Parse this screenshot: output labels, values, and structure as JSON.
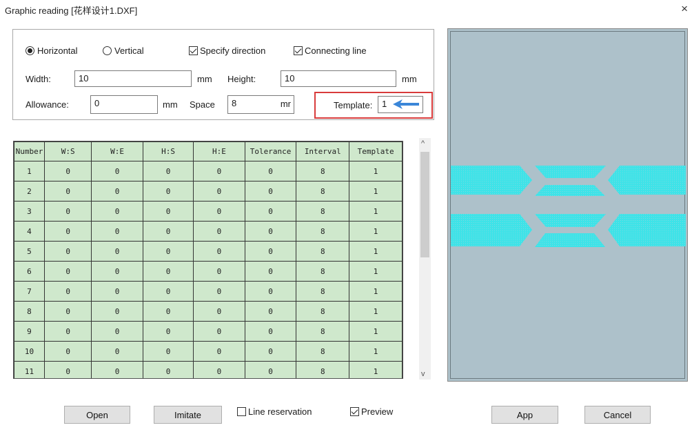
{
  "window": {
    "title": "Graphic reading [花样设计1.DXF]",
    "close_glyph": "×"
  },
  "options": {
    "horizontal_label": "Horizontal",
    "horizontal_selected": true,
    "vertical_label": "Vertical",
    "vertical_selected": false,
    "specify_direction_label": "Specify direction",
    "specify_direction_checked": true,
    "connecting_line_label": "Connecting line",
    "connecting_line_checked": true
  },
  "fields": {
    "width_label": "Width:",
    "width_value": "10",
    "width_unit": "mm",
    "height_label": "Height:",
    "height_value": "10",
    "height_unit": "mm",
    "allowance_label": "Allowance:",
    "allowance_value": "0",
    "allowance_unit": "mm",
    "space_label": "Space",
    "space_value": "8",
    "space_unit": "mr",
    "template_label": "Template:",
    "template_value": "1"
  },
  "highlight_color": "#d83b3b",
  "arrow_color": "#3a86d8",
  "table": {
    "headers": [
      "Number",
      "W:S",
      "W:E",
      "H:S",
      "H:E",
      "Tolerance",
      "Interval",
      "Template"
    ],
    "rows": [
      [
        "1",
        "0",
        "0",
        "0",
        "0",
        "0",
        "8",
        "1"
      ],
      [
        "2",
        "0",
        "0",
        "0",
        "0",
        "0",
        "8",
        "1"
      ],
      [
        "3",
        "0",
        "0",
        "0",
        "0",
        "0",
        "8",
        "1"
      ],
      [
        "4",
        "0",
        "0",
        "0",
        "0",
        "0",
        "8",
        "1"
      ],
      [
        "5",
        "0",
        "0",
        "0",
        "0",
        "0",
        "8",
        "1"
      ],
      [
        "6",
        "0",
        "0",
        "0",
        "0",
        "0",
        "8",
        "1"
      ],
      [
        "7",
        "0",
        "0",
        "0",
        "0",
        "0",
        "8",
        "1"
      ],
      [
        "8",
        "0",
        "0",
        "0",
        "0",
        "0",
        "8",
        "1"
      ],
      [
        "9",
        "0",
        "0",
        "0",
        "0",
        "0",
        "8",
        "1"
      ],
      [
        "10",
        "0",
        "0",
        "0",
        "0",
        "0",
        "8",
        "1"
      ],
      [
        "11",
        "0",
        "0",
        "0",
        "0",
        "0",
        "8",
        "1"
      ]
    ],
    "cell_color": "#cfe8cc"
  },
  "scrollbar": {
    "up_glyph": "^",
    "down_glyph": "v"
  },
  "preview": {
    "background_color": "#adc1ca",
    "pattern_color": "#3ee3e8"
  },
  "buttons": {
    "open_label": "Open",
    "imitate_label": "Imitate",
    "line_reservation_label": "Line reservation",
    "line_reservation_checked": false,
    "preview_label": "Preview",
    "preview_checked": true,
    "app_label": "App",
    "cancel_label": "Cancel"
  }
}
